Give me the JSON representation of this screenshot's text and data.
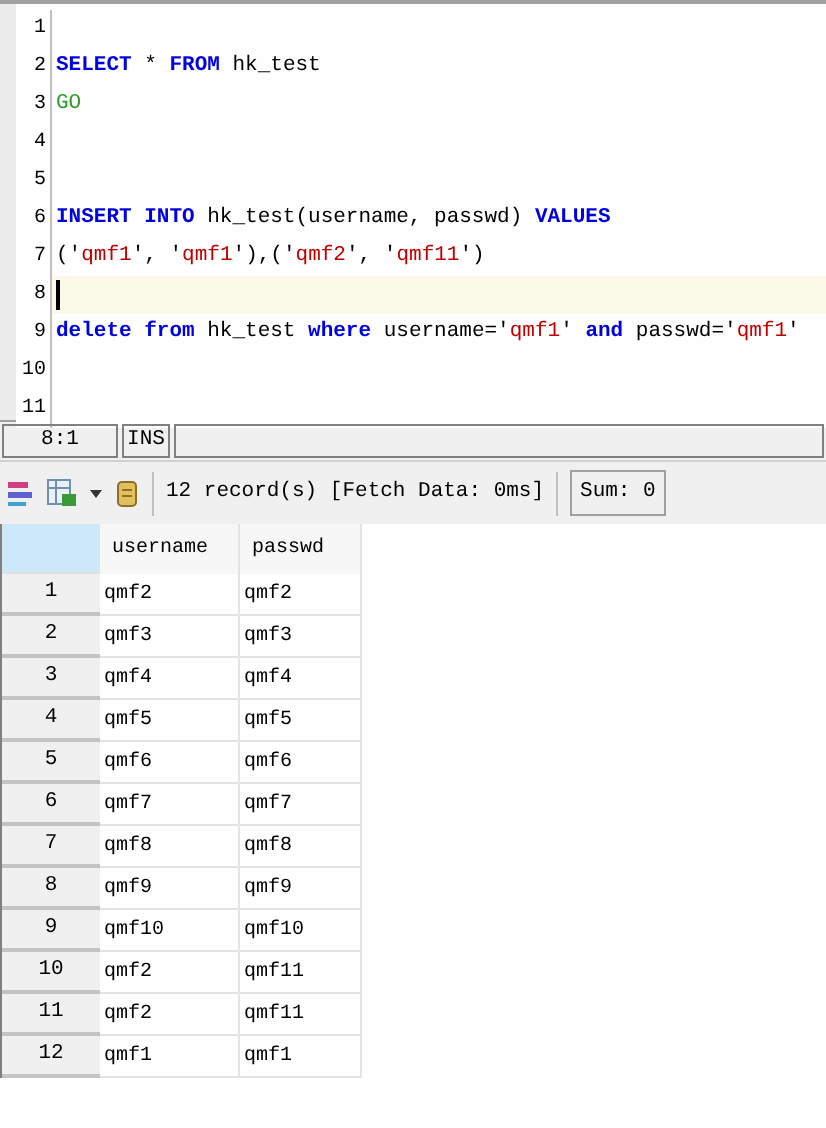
{
  "editor": {
    "lines": [
      {
        "number": "1",
        "current": false
      },
      {
        "number": "2",
        "current": false,
        "tokens": [
          {
            "kind": "keyword",
            "text": "SELECT"
          },
          {
            "kind": "plain",
            "text": " * "
          },
          {
            "kind": "keyword",
            "text": "FROM"
          },
          {
            "kind": "plain",
            "text": " hk_test"
          }
        ]
      },
      {
        "number": "3",
        "current": false,
        "tokens": [
          {
            "kind": "batch",
            "text": "GO"
          }
        ]
      },
      {
        "number": "4",
        "current": false
      },
      {
        "number": "5",
        "current": false
      },
      {
        "number": "6",
        "current": false,
        "tokens": [
          {
            "kind": "keyword",
            "text": "INSERT INTO"
          },
          {
            "kind": "plain",
            "text": " hk_test(username, passwd) "
          },
          {
            "kind": "keyword",
            "text": "VALUES"
          }
        ]
      },
      {
        "number": "7",
        "current": false,
        "tokens": [
          {
            "kind": "plain",
            "text": "('"
          },
          {
            "kind": "string",
            "text": "qmf1"
          },
          {
            "kind": "plain",
            "text": "', '"
          },
          {
            "kind": "string",
            "text": "qmf1"
          },
          {
            "kind": "plain",
            "text": "'),('"
          },
          {
            "kind": "string",
            "text": "qmf2"
          },
          {
            "kind": "plain",
            "text": "', '"
          },
          {
            "kind": "string",
            "text": "qmf11"
          },
          {
            "kind": "plain",
            "text": "')"
          }
        ]
      },
      {
        "number": "8",
        "current": true
      },
      {
        "number": "9",
        "current": false,
        "tokens": [
          {
            "kind": "keyword",
            "text": "delete from"
          },
          {
            "kind": "plain",
            "text": " hk_test "
          },
          {
            "kind": "keyword",
            "text": "where"
          },
          {
            "kind": "plain",
            "text": " username='"
          },
          {
            "kind": "string",
            "text": "qmf1"
          },
          {
            "kind": "plain",
            "text": "' "
          },
          {
            "kind": "keyword",
            "text": "and"
          },
          {
            "kind": "plain",
            "text": " passwd='"
          },
          {
            "kind": "string",
            "text": "qmf1"
          },
          {
            "kind": "plain",
            "text": "'"
          }
        ]
      },
      {
        "number": "10",
        "current": false
      },
      {
        "number": "11",
        "current": false
      }
    ]
  },
  "status_bar": {
    "position": "8:1",
    "mode": "INS"
  },
  "results_toolbar": {
    "record_info": "12 record(s) [Fetch Data: 0ms]",
    "sum": "Sum: 0"
  },
  "grid": {
    "columns": [
      "username",
      "passwd"
    ],
    "rows": [
      {
        "number": "1",
        "cells": [
          "qmf2",
          "qmf2"
        ]
      },
      {
        "number": "2",
        "cells": [
          "qmf3",
          "qmf3"
        ]
      },
      {
        "number": "3",
        "cells": [
          "qmf4",
          "qmf4"
        ]
      },
      {
        "number": "4",
        "cells": [
          "qmf5",
          "qmf5"
        ]
      },
      {
        "number": "5",
        "cells": [
          "qmf6",
          "qmf6"
        ]
      },
      {
        "number": "6",
        "cells": [
          "qmf7",
          "qmf7"
        ]
      },
      {
        "number": "7",
        "cells": [
          "qmf8",
          "qmf8"
        ]
      },
      {
        "number": "8",
        "cells": [
          "qmf9",
          "qmf9"
        ]
      },
      {
        "number": "9",
        "cells": [
          "qmf10",
          "qmf10"
        ]
      },
      {
        "number": "10",
        "cells": [
          "qmf2",
          "qmf11"
        ]
      },
      {
        "number": "11",
        "cells": [
          "qmf2",
          "qmf11"
        ]
      },
      {
        "number": "12",
        "cells": [
          "qmf1",
          "qmf1"
        ]
      }
    ]
  }
}
